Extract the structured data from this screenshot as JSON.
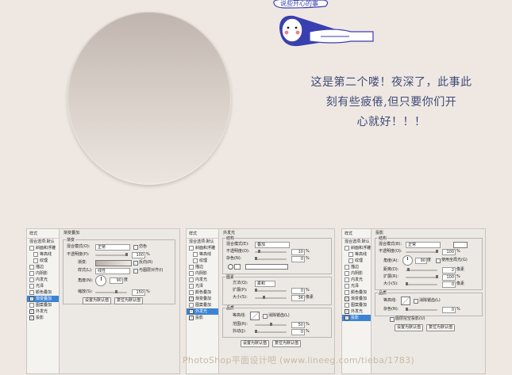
{
  "banner_text": "说些开心的事",
  "quote_lines": [
    "这是第二个喽！夜深了，此事此",
    "刻有些疲倦,但只要你们开",
    "心就好！！！"
  ],
  "panels": [
    {
      "style_header": "样式",
      "blend_default": "混合选项:默认",
      "items": [
        {
          "label": "斜面和浮雕",
          "checked": false,
          "indent": false,
          "selected": false
        },
        {
          "label": "等高线",
          "checked": false,
          "indent": true,
          "selected": false
        },
        {
          "label": "纹理",
          "checked": false,
          "indent": true,
          "selected": false
        },
        {
          "label": "描边",
          "checked": false,
          "indent": false,
          "selected": false
        },
        {
          "label": "内阴影",
          "checked": false,
          "indent": false,
          "selected": false
        },
        {
          "label": "内发光",
          "checked": false,
          "indent": false,
          "selected": false
        },
        {
          "label": "光泽",
          "checked": false,
          "indent": false,
          "selected": false
        },
        {
          "label": "颜色叠加",
          "checked": false,
          "indent": false,
          "selected": false
        },
        {
          "label": "渐变叠加",
          "checked": true,
          "indent": false,
          "selected": true
        },
        {
          "label": "图案叠加",
          "checked": false,
          "indent": false,
          "selected": false
        },
        {
          "label": "外发光",
          "checked": true,
          "indent": false,
          "selected": false
        },
        {
          "label": "投影",
          "checked": true,
          "indent": false,
          "selected": false
        }
      ],
      "section": "渐变叠加",
      "group": "渐变",
      "blend_mode_label": "混合模式(O):",
      "blend_mode_value": "正常",
      "dither_label": "仿色",
      "opacity_label": "不透明度(P):",
      "opacity_value": "100",
      "gradient_label": "渐变:",
      "reverse_label": "反向(R)",
      "style_label": "样式(L):",
      "style_value": "线性",
      "align_label": "与图层对齐(I)",
      "angle_label": "角度(N):",
      "angle_value": "90",
      "angle_unit": "度",
      "scale_label": "缩放(S):",
      "scale_value": "150",
      "percent": "%",
      "btn_default": "设置为默认值",
      "btn_reset": "复位为默认值"
    },
    {
      "style_header": "样式",
      "blend_default": "混合选项:默认",
      "items": [
        {
          "label": "斜面和浮雕",
          "checked": false,
          "indent": false,
          "selected": false
        },
        {
          "label": "等高线",
          "checked": false,
          "indent": true,
          "selected": false
        },
        {
          "label": "纹理",
          "checked": false,
          "indent": true,
          "selected": false
        },
        {
          "label": "描边",
          "checked": false,
          "indent": false,
          "selected": false
        },
        {
          "label": "内阴影",
          "checked": false,
          "indent": false,
          "selected": false
        },
        {
          "label": "内发光",
          "checked": false,
          "indent": false,
          "selected": false
        },
        {
          "label": "光泽",
          "checked": false,
          "indent": false,
          "selected": false
        },
        {
          "label": "颜色叠加",
          "checked": false,
          "indent": false,
          "selected": false
        },
        {
          "label": "渐变叠加",
          "checked": true,
          "indent": false,
          "selected": false
        },
        {
          "label": "图案叠加",
          "checked": false,
          "indent": false,
          "selected": false
        },
        {
          "label": "外发光",
          "checked": true,
          "indent": false,
          "selected": true
        },
        {
          "label": "投影",
          "checked": true,
          "indent": false,
          "selected": false
        }
      ],
      "section": "外发光",
      "group_structure": "结构",
      "blend_mode_label": "混合模式(E):",
      "blend_mode_value": "叠加",
      "opacity_label": "不透明度(O):",
      "opacity_value": "10",
      "noise_label": "杂色(N):",
      "noise_value": "0",
      "group_elements": "图素",
      "technique_label": "方法(Q):",
      "technique_value": "柔和",
      "spread_label": "扩展(P):",
      "spread_value": "0",
      "size_label": "大小(S):",
      "size_value": "36",
      "px": "像素",
      "group_quality": "品质",
      "contour_label": "等高线:",
      "antialias_label": "消除锯齿(L)",
      "range_label": "范围(R):",
      "range_value": "50",
      "jitter_label": "抖动(J):",
      "jitter_value": "0",
      "percent": "%",
      "btn_default": "设置为默认值",
      "btn_reset": "复位为默认值"
    },
    {
      "style_header": "样式",
      "blend_default": "混合选项:默认",
      "items": [
        {
          "label": "斜面和浮雕",
          "checked": false,
          "indent": false,
          "selected": false
        },
        {
          "label": "等高线",
          "checked": false,
          "indent": true,
          "selected": false
        },
        {
          "label": "纹理",
          "checked": false,
          "indent": true,
          "selected": false
        },
        {
          "label": "描边",
          "checked": false,
          "indent": false,
          "selected": false
        },
        {
          "label": "内阴影",
          "checked": false,
          "indent": false,
          "selected": false
        },
        {
          "label": "内发光",
          "checked": false,
          "indent": false,
          "selected": false
        },
        {
          "label": "光泽",
          "checked": false,
          "indent": false,
          "selected": false
        },
        {
          "label": "颜色叠加",
          "checked": false,
          "indent": false,
          "selected": false
        },
        {
          "label": "渐变叠加",
          "checked": true,
          "indent": false,
          "selected": false
        },
        {
          "label": "图案叠加",
          "checked": false,
          "indent": false,
          "selected": false
        },
        {
          "label": "外发光",
          "checked": true,
          "indent": false,
          "selected": false
        },
        {
          "label": "投影",
          "checked": true,
          "indent": false,
          "selected": true
        }
      ],
      "section": "投影",
      "group_structure": "结构",
      "blend_mode_label": "混合模式(B):",
      "blend_mode_value": "正常",
      "opacity_label": "不透明度(O):",
      "opacity_value": "100",
      "angle_label": "角度(A):",
      "angle_value": "90",
      "angle_unit": "度",
      "global_light_label": "使用全局光(G)",
      "distance_label": "距离(D):",
      "distance_value": "2",
      "spread_label": "扩展(R):",
      "spread_value": "100",
      "size_label": "大小(S):",
      "size_value": "0",
      "px": "像素",
      "group_quality": "品质",
      "contour_label": "等高线:",
      "antialias_label": "消除锯齿(L)",
      "noise_label": "杂色(N):",
      "noise_value": "0",
      "knockout_label": "图层挖空投影(U)",
      "percent": "%",
      "btn_default": "设置为默认值",
      "btn_reset": "复位为默认值"
    }
  ],
  "watermark": "PhotoShop平面设计吧 (www.lineeg.com/tieba/1783)",
  "colors": {
    "background": "#efe8e2",
    "quote": "#3f4a78",
    "selected": "#3c84d3",
    "sticker_blue": "#3a3fb0"
  }
}
